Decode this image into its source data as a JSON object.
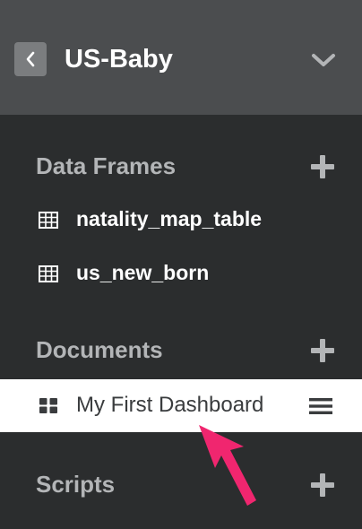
{
  "header": {
    "title": "US-Baby",
    "back_icon": "chevron-left-icon",
    "menu_icon": "chevron-down-icon"
  },
  "sections": {
    "data_frames": {
      "title": "Data Frames",
      "items": [
        {
          "label": "natality_map_table",
          "icon": "table-icon"
        },
        {
          "label": "us_new_born",
          "icon": "table-icon"
        }
      ]
    },
    "documents": {
      "title": "Documents",
      "items": [
        {
          "label": "My First Dashboard",
          "icon": "dashboard-icon",
          "selected": true
        }
      ]
    },
    "scripts": {
      "title": "Scripts",
      "items": []
    }
  },
  "colors": {
    "background": "#2b2d2e",
    "header_background": "#4b4d4f",
    "section_title": "#b3b5b7",
    "selected_background": "#ffffff",
    "annotation_arrow": "#f0266f"
  }
}
